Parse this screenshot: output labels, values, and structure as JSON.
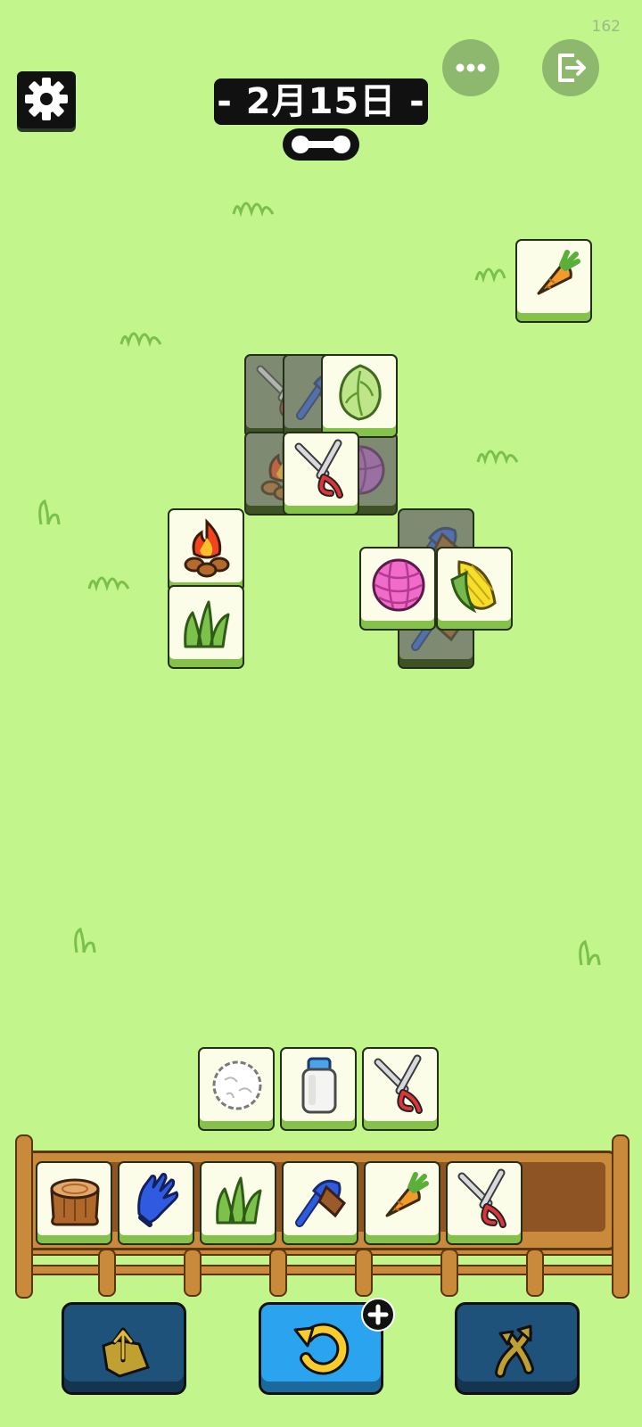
{
  "header": {
    "date_label": "- 2月15日 -",
    "corner_counter": "162"
  },
  "icons": {
    "settings": "gear-icon",
    "more": "more-dots-icon",
    "exit": "exit-icon",
    "progress": "bone-icon"
  },
  "board_tiles": [
    {
      "item": "carrot",
      "state": "free"
    },
    {
      "item": "shears",
      "state": "blocked"
    },
    {
      "item": "blue-brush",
      "state": "blocked"
    },
    {
      "item": "cabbage",
      "state": "free"
    },
    {
      "item": "campfire",
      "state": "blocked"
    },
    {
      "item": "shears",
      "state": "free"
    },
    {
      "item": "purple-cabbage",
      "state": "blocked"
    },
    {
      "item": "campfire",
      "state": "free"
    },
    {
      "item": "grass",
      "state": "free"
    },
    {
      "item": "blue-brush",
      "state": "blocked"
    },
    {
      "item": "yarn-ball",
      "state": "free"
    },
    {
      "item": "corn",
      "state": "free"
    },
    {
      "item": "blue-brush",
      "state": "blocked"
    }
  ],
  "pending_row": [
    "cotton",
    "milk-jar",
    "shears"
  ],
  "tray": {
    "capacity": 7,
    "items": [
      "tree-stump",
      "blue-glove",
      "grass",
      "blue-brush",
      "carrot",
      "shears"
    ]
  },
  "tools": [
    {
      "name": "remove",
      "icon": "tray-out-icon"
    },
    {
      "name": "undo",
      "icon": "undo-arrow-icon",
      "badge": "plus-icon"
    },
    {
      "name": "shuffle",
      "icon": "shuffle-arrows-icon"
    }
  ],
  "colors": {
    "background": "#c2f58b",
    "tile_face": "#fbfde8",
    "tile_base": "#84c24a",
    "undo_button": "#2aa4ef",
    "dark_button": "#1e527a"
  }
}
